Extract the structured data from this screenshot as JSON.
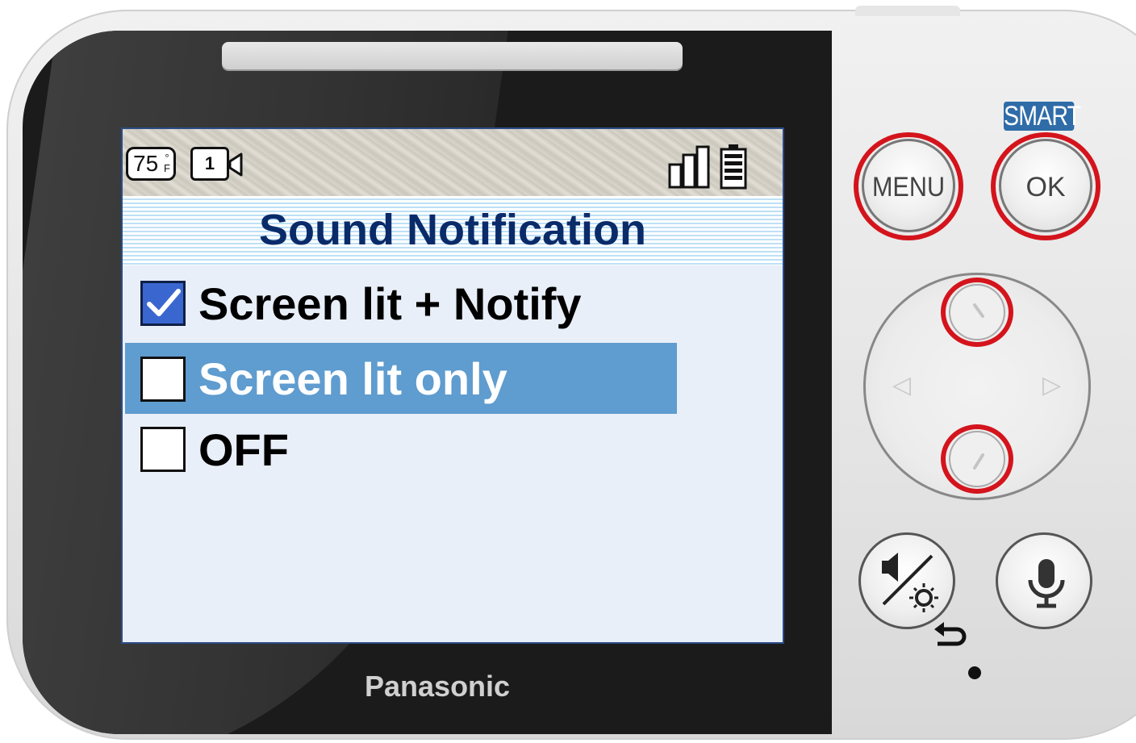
{
  "status_bar": {
    "temperature": "75",
    "temperature_unit_top": "°",
    "temperature_unit_bottom": "F",
    "camera_number": "1",
    "signal_icon": "signal-bars-icon",
    "battery_icon": "battery-icon"
  },
  "menu": {
    "title": "Sound Notification",
    "options": [
      {
        "label": "Screen lit + Notify",
        "checked": true,
        "highlighted": false
      },
      {
        "label": "Screen lit only",
        "checked": false,
        "highlighted": true
      },
      {
        "label": "OFF",
        "checked": false,
        "highlighted": false
      }
    ]
  },
  "device": {
    "brand": "Panasonic",
    "smart_label": "SMART",
    "menu_button": "MENU",
    "ok_button": "OK"
  },
  "colors": {
    "title_text": "#0a2b6a",
    "highlight": "#5f9ccf",
    "checkbox_checked": "#3a67cf",
    "ring_red": "#d4141c",
    "smart_badge": "#2f6ca8"
  }
}
